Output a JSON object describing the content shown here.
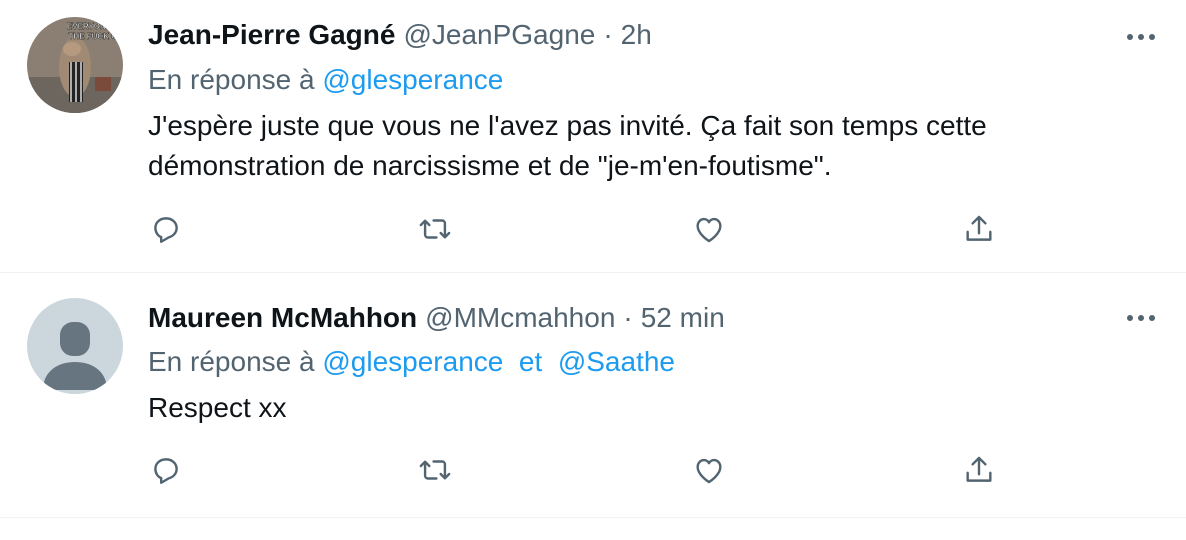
{
  "tweets": [
    {
      "author_name": "Jean-Pierre Gagné",
      "handle": "@JeanPGagne",
      "separator": "·",
      "time": "2h",
      "reply_prefix": "En réponse à",
      "mentions": [
        "@glesperance"
      ],
      "text": "J'espère juste que vous ne l'avez pas invité. Ça fait son temps cette démonstration de narcissisme et de \"je-m'en-foutisme\".",
      "avatar_caption": "EVERYONE ... THE FUCK O..."
    },
    {
      "author_name": "Maureen McMahhon",
      "handle": "@MMcmahhon",
      "separator": "·",
      "time": "52 min",
      "reply_prefix": "En réponse à",
      "mentions": [
        "@glesperance",
        "@Saathe"
      ],
      "mention_joiner": "et",
      "text": "Respect xx"
    }
  ],
  "colors": {
    "text": "#0f1419",
    "secondary": "#536471",
    "accent": "#1d9bf0",
    "divider": "#eff3f4",
    "default_avatar_bg": "#ccd6dd",
    "default_avatar_fg": "#66757f"
  },
  "icons": [
    "more-icon",
    "reply-icon",
    "retweet-icon",
    "like-icon",
    "share-icon"
  ]
}
